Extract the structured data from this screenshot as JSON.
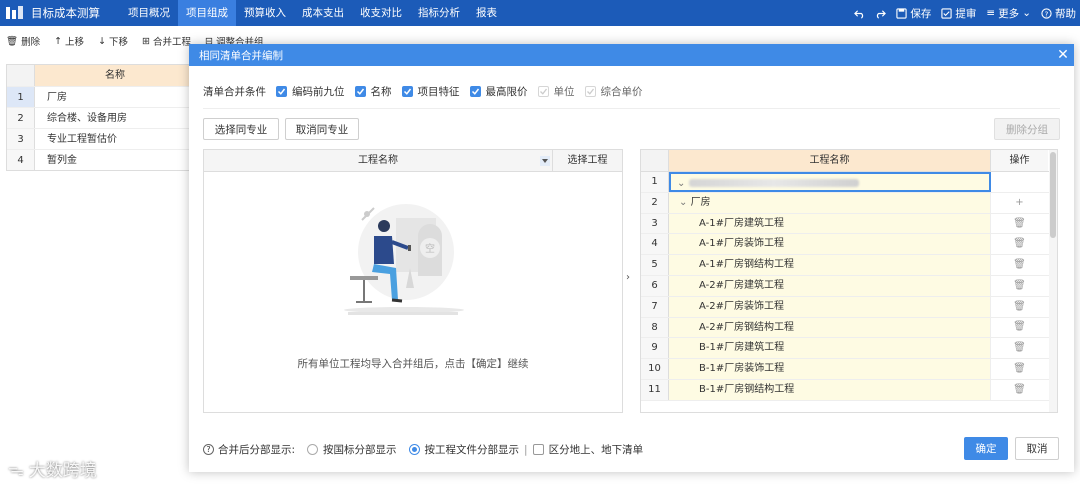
{
  "app": {
    "title": "目标成本测算"
  },
  "nav": [
    "项目概况",
    "项目组成",
    "预算收入",
    "成本支出",
    "收支对比",
    "指标分析",
    "报表"
  ],
  "nav_active": 1,
  "top_right": {
    "save": "保存",
    "submit": "提审",
    "more": "更多",
    "help": "帮助"
  },
  "toolbar": {
    "delete": "删除",
    "up": "上移",
    "down": "下移",
    "merge": "合并工程",
    "adjust": "调整合并组"
  },
  "bg_table": {
    "header": "名称",
    "rows": [
      {
        "idx": "1",
        "name": "厂房"
      },
      {
        "idx": "2",
        "name": "综合楼、设备用房"
      },
      {
        "idx": "3",
        "name": "专业工程暂估价"
      },
      {
        "idx": "4",
        "name": "暂列金"
      }
    ]
  },
  "dialog": {
    "title": "相同清单合并编制",
    "cond_label": "清单合并条件",
    "conditions": [
      {
        "label": "编码前九位",
        "state": "on"
      },
      {
        "label": "名称",
        "state": "on"
      },
      {
        "label": "项目特征",
        "state": "on"
      },
      {
        "label": "最高限价",
        "state": "on"
      },
      {
        "label": "单位",
        "state": "dis"
      },
      {
        "label": "综合单价",
        "state": "dis"
      }
    ],
    "select_same": "选择同专业",
    "cancel_same": "取消同专业",
    "remove_group": "删除分组",
    "left": {
      "col_name": "工程名称",
      "col_select": "选择工程",
      "empty_badge": "空",
      "empty_text": "所有单位工程均导入合并组后，点击【确定】继续"
    },
    "right": {
      "col_name": "工程名称",
      "col_op": "操作",
      "rows": [
        {
          "idx": "1",
          "name": "",
          "type": "top"
        },
        {
          "idx": "2",
          "name": "厂房",
          "type": "grp"
        },
        {
          "idx": "3",
          "name": "A-1#厂房建筑工程",
          "type": "sub"
        },
        {
          "idx": "4",
          "name": "A-1#厂房装饰工程",
          "type": "sub"
        },
        {
          "idx": "5",
          "name": "A-1#厂房钢结构工程",
          "type": "sub"
        },
        {
          "idx": "6",
          "name": "A-2#厂房建筑工程",
          "type": "sub"
        },
        {
          "idx": "7",
          "name": "A-2#厂房装饰工程",
          "type": "sub"
        },
        {
          "idx": "8",
          "name": "A-2#厂房钢结构工程",
          "type": "sub"
        },
        {
          "idx": "9",
          "name": "B-1#厂房建筑工程",
          "type": "sub"
        },
        {
          "idx": "10",
          "name": "B-1#厂房装饰工程",
          "type": "sub"
        },
        {
          "idx": "11",
          "name": "B-1#厂房钢结构工程",
          "type": "sub"
        }
      ]
    },
    "footer": {
      "label": "合并后分部显示:",
      "opt1": "按国标分部显示",
      "opt2": "按工程文件分部显示",
      "sep": "|",
      "opt3": "区分地上、地下清单"
    },
    "ok": "确定",
    "cancel": "取消"
  },
  "brand": "大数跨境",
  "colors": {
    "primary": "#1c5bb8",
    "accent": "#3f8ae6",
    "header_peach": "#fce8cf",
    "row_yellow": "#fefbe3"
  }
}
